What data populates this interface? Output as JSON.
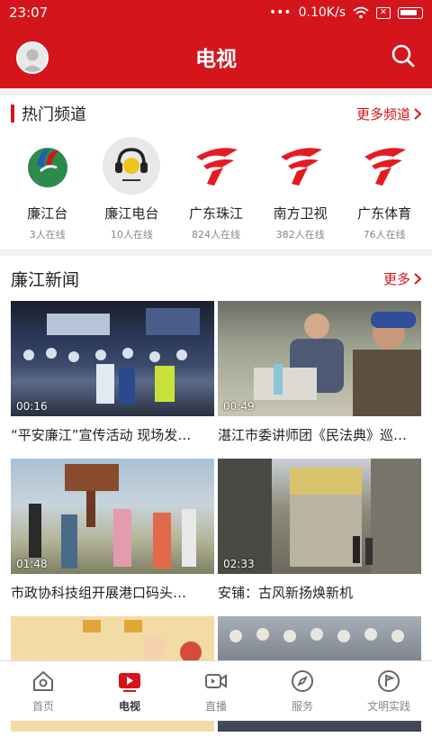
{
  "status": {
    "time": "23:07",
    "dots": "•••",
    "speed": "0.10K/s",
    "sim": "✕"
  },
  "header": {
    "title": "电视"
  },
  "hot_channels": {
    "title": "热门频道",
    "more": "更多频道",
    "items": [
      {
        "name": "廉江台",
        "count": "3人在线"
      },
      {
        "name": "廉江电台",
        "count": "10人在线"
      },
      {
        "name": "广东珠江",
        "count": "824人在线"
      },
      {
        "name": "南方卫视",
        "count": "382人在线"
      },
      {
        "name": "广东体育",
        "count": "76人在线"
      }
    ]
  },
  "news": {
    "title": "廉江新闻",
    "more": "更多",
    "items": [
      {
        "caption": "“平安廉江”宣传活动 现场发…",
        "duration": "00:16"
      },
      {
        "caption": "湛江市委讲师团《民法典》巡…",
        "duration": "00:49"
      },
      {
        "caption": "市政协科技组开展港口码头…",
        "duration": "01:48"
      },
      {
        "caption": "安铺：古风新扬焕新机",
        "duration": "02:33"
      },
      {
        "caption": "",
        "duration": ""
      },
      {
        "caption": "",
        "duration": ""
      }
    ]
  },
  "tabs": [
    {
      "label": "首页",
      "icon": "home-icon"
    },
    {
      "label": "电视",
      "icon": "tv-icon"
    },
    {
      "label": "直播",
      "icon": "live-camera-icon"
    },
    {
      "label": "服务",
      "icon": "compass-icon"
    },
    {
      "label": "文明实践",
      "icon": "flag-icon"
    }
  ],
  "colors": {
    "brand": "#d4161c"
  }
}
